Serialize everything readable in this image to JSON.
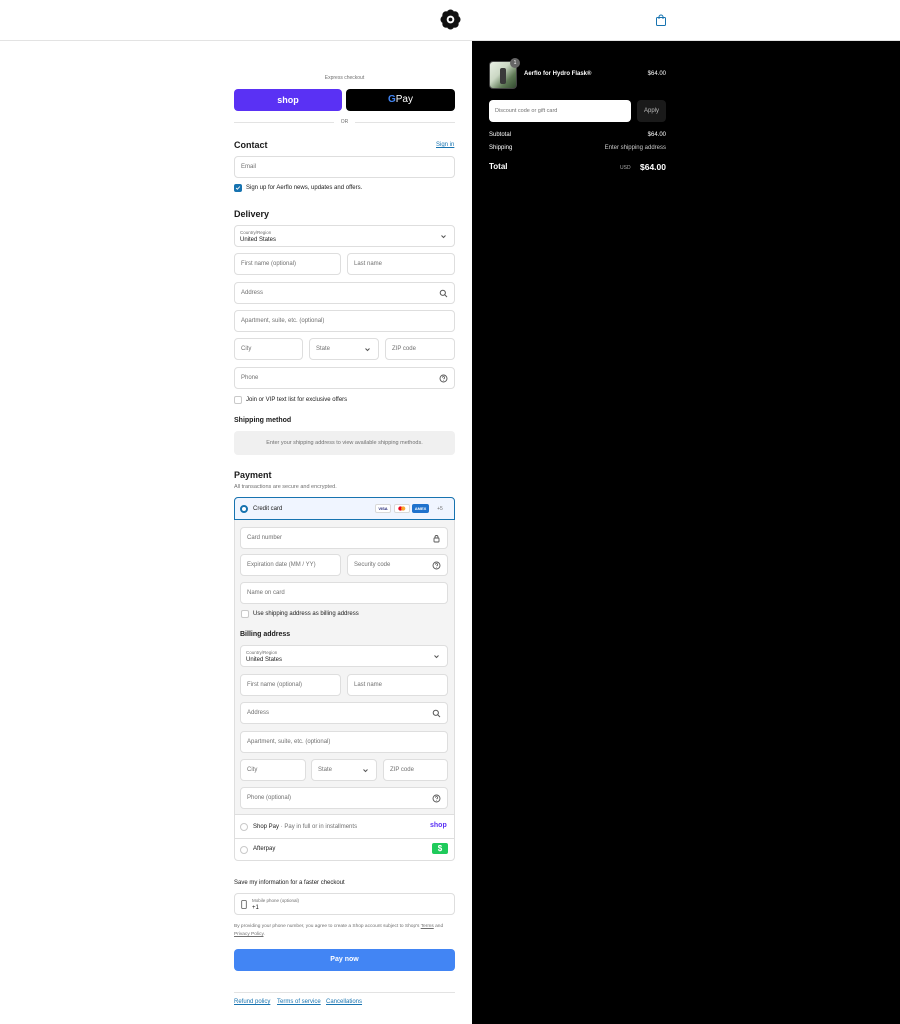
{
  "header": {
    "logo": "aerflo-logo",
    "cart_icon": "shopping-bag-icon"
  },
  "express": {
    "label": "Express checkout",
    "shop_label": "shop",
    "gpay_g": "G",
    "gpay_label": "Pay",
    "or_label": "OR"
  },
  "contact": {
    "title": "Contact",
    "sign_in": "Sign in",
    "email_placeholder": "Email",
    "newsletter_label": "Sign up for Aerflo news, updates and offers."
  },
  "delivery": {
    "title": "Delivery",
    "country_label": "Country/Region",
    "country_value": "United States",
    "first_name": "First name (optional)",
    "last_name": "Last name",
    "address": "Address",
    "apartment": "Apartment, suite, etc. (optional)",
    "city": "City",
    "state": "State",
    "zip": "ZIP code",
    "phone": "Phone",
    "vip_label": "Join or VIP text list for exclusive offers"
  },
  "shipping": {
    "title": "Shipping method",
    "message": "Enter your shipping address to view available shipping methods."
  },
  "payment": {
    "title": "Payment",
    "subtitle": "All transactions are secure and encrypted.",
    "credit_card_label": "Credit card",
    "card_brands": [
      "VISA",
      "",
      "AMEX",
      "+5"
    ],
    "card_number": "Card number",
    "expiration": "Expiration date (MM / YY)",
    "security_code": "Security code",
    "name_on_card": "Name on card",
    "use_shipping_label": "Use shipping address as billing address"
  },
  "billing": {
    "title": "Billing address",
    "country_label": "Country/Region",
    "country_value": "United States",
    "first_name": "First name (optional)",
    "last_name": "Last name",
    "address": "Address",
    "apartment": "Apartment, suite, etc. (optional)",
    "city": "City",
    "state": "State",
    "zip": "ZIP code",
    "phone": "Phone (optional)"
  },
  "alt_payments": {
    "shoppay_label": "Shop Pay",
    "shoppay_sub": "· Pay in full or in installments",
    "shoppay_logo": "shop",
    "afterpay_label": "Afterpay",
    "afterpay_logo": "$"
  },
  "save_info": {
    "title": "Save my information for a faster checkout",
    "mobile_label": "Mobile phone (optional)",
    "mobile_value": "+1",
    "disclaimer": "By providing your phone number, you agree to create a Shop account subject to Shop's",
    "terms": "Terms",
    "and": "and",
    "privacy": "Privacy Policy",
    "period": "."
  },
  "pay_now": "Pay now",
  "footer_links": [
    "Refund policy",
    "Terms of service",
    "Cancellations"
  ],
  "summary": {
    "item_name": "Aerflo for Hydro Flask®",
    "item_price": "$64.00",
    "item_qty": "1",
    "discount_placeholder": "Discount code or gift card",
    "apply": "Apply",
    "subtotal_label": "Subtotal",
    "subtotal_value": "$64.00",
    "shipping_label": "Shipping",
    "shipping_value": "Enter shipping address",
    "total_label": "Total",
    "currency": "USD",
    "total_value": "$64.00"
  },
  "colors": {
    "accent": "#1773b0",
    "shop_purple": "#5a31f4",
    "pay_button": "#4285f4",
    "afterpay_green": "#1fca5b"
  }
}
